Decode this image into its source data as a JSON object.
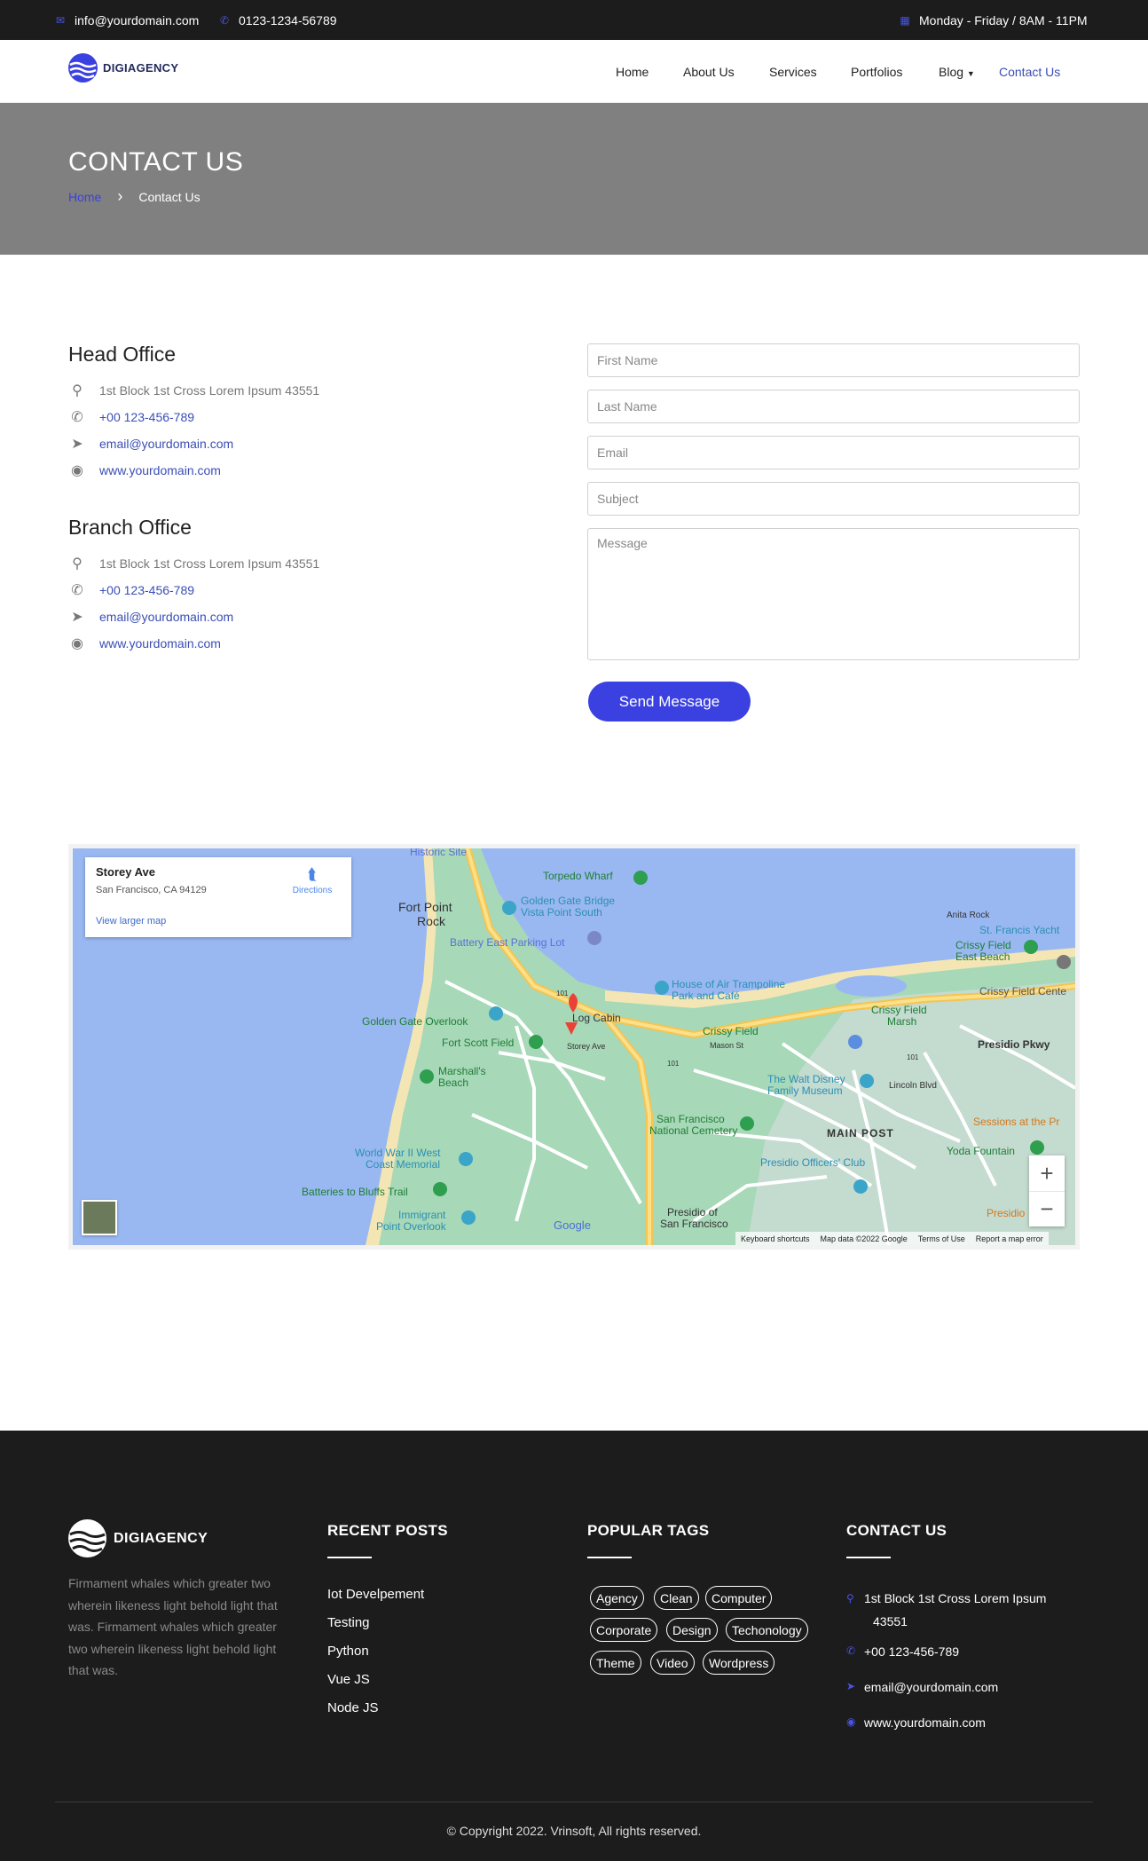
{
  "topbar": {
    "email": "info@yourdomain.com",
    "phone": "0123-1234-56789",
    "hours": "Monday - Friday / 8AM - 11PM"
  },
  "brand": {
    "name": "DIGIAGENCY"
  },
  "nav": {
    "items": [
      "Home",
      "About Us",
      "Services",
      "Portfolios",
      "Blog",
      "Contact Us"
    ],
    "active": "Contact Us"
  },
  "hero": {
    "title": "CONTACT US",
    "crumb_home": "Home",
    "crumb_sep": "›",
    "crumb_current": "Contact Us"
  },
  "offices": [
    {
      "title": "Head Office",
      "address": "1st Block 1st Cross Lorem Ipsum 43551",
      "phone": "+00 123-456-789",
      "email": "email@yourdomain.com",
      "web": "www.yourdomain.com"
    },
    {
      "title": "Branch Office",
      "address": "1st Block 1st Cross Lorem Ipsum 43551",
      "phone": "+00 123-456-789",
      "email": "email@yourdomain.com",
      "web": "www.yourdomain.com"
    }
  ],
  "form": {
    "first_name": "First Name",
    "last_name": "Last Name",
    "email": "Email",
    "subject": "Subject",
    "message": "Message",
    "submit": "Send Message"
  },
  "map": {
    "place_name": "Storey Ave",
    "place_address": "San Francisco, CA 94129",
    "directions": "Directions",
    "larger_map": "View larger map",
    "labels": {
      "historic_site": "Historic Site",
      "torpedo_wharf": "Torpedo Wharf",
      "fort_point": "Fort Point",
      "rock": "Rock",
      "ggb_vista": "Golden Gate Bridge",
      "ggb_vista2": "Vista Point South",
      "battery_east": "Battery East Parking Lot",
      "anita_rock": "Anita Rock",
      "st_francis": "St. Francis Yacht",
      "crissy_east": "Crissy Field",
      "crissy_east2": "East Beach",
      "crissy_center": "Crissy Field Cente",
      "house_air": "House of Air Trampoline",
      "house_air2": "Park and Café",
      "gg_overlook": "Golden Gate Overlook",
      "log_cabin": "Log Cabin",
      "crissy_marsh": "Crissy Field",
      "crissy_marsh2": "Marsh",
      "crissy_field": "Crissy Field",
      "fort_scott": "Fort Scott Field",
      "storey_ave": "Storey Ave",
      "mason_st": "Mason St",
      "presidio_pkwy": "Presidio Pkwy",
      "marshalls": "Marshall's",
      "beach": "Beach",
      "walt_disney": "The Walt Disney",
      "walt_disney2": "Family Museum",
      "lincoln": "Lincoln Blvd",
      "sessions": "Sessions at the Pr",
      "sf_cemetery": "San Francisco",
      "sf_cemetery2": "National Cemetery",
      "main_post": "MAIN POST",
      "wwii": "World War II West",
      "wwii2": "Coast Memorial",
      "yoda": "Yoda Fountain",
      "batteries": "Batteries to Bluffs Trail",
      "presidio_officers": "Presidio Officers' Club",
      "immigrant": "Immigrant",
      "immigrant2": "Point Overlook",
      "presidio_sf": "Presidio of",
      "presidio_sf2": "San Francisco",
      "presidio_r": "Presidio",
      "hwy": "101",
      "google": "Google"
    },
    "footer": {
      "shortcuts": "Keyboard shortcuts",
      "data": "Map data ©2022 Google",
      "terms": "Terms of Use",
      "report": "Report a map error"
    },
    "zoom_in": "+",
    "zoom_out": "−"
  },
  "footer": {
    "about": "Firmament whales which greater two wherein likeness light behold light that was. Firmament whales which greater two wherein likeness light behold light that was.",
    "recent_title": "RECENT POSTS",
    "recent_posts": [
      "Iot Develpement",
      "Testing",
      "Python",
      "Vue JS",
      "Node JS"
    ],
    "tags_title": "POPULAR TAGS",
    "tags": [
      "Agency",
      "Clean",
      "Computer",
      "Corporate",
      "Design",
      "Techonology",
      "Theme",
      "Video",
      "Wordpress"
    ],
    "contact_title": "CONTACT US",
    "contact_address": "1st Block 1st Cross Lorem Ipsum",
    "contact_address2": "43551",
    "contact_phone": "+00 123-456-789",
    "contact_email": "email@yourdomain.com",
    "contact_web": "www.yourdomain.com",
    "copyright": "© Copyright 2022. Vrinsoft, All rights reserved."
  },
  "colors": {
    "accent": "#3b40e0",
    "link": "#3a4eb5",
    "dark": "#1c1c1d",
    "hero": "#808080"
  }
}
